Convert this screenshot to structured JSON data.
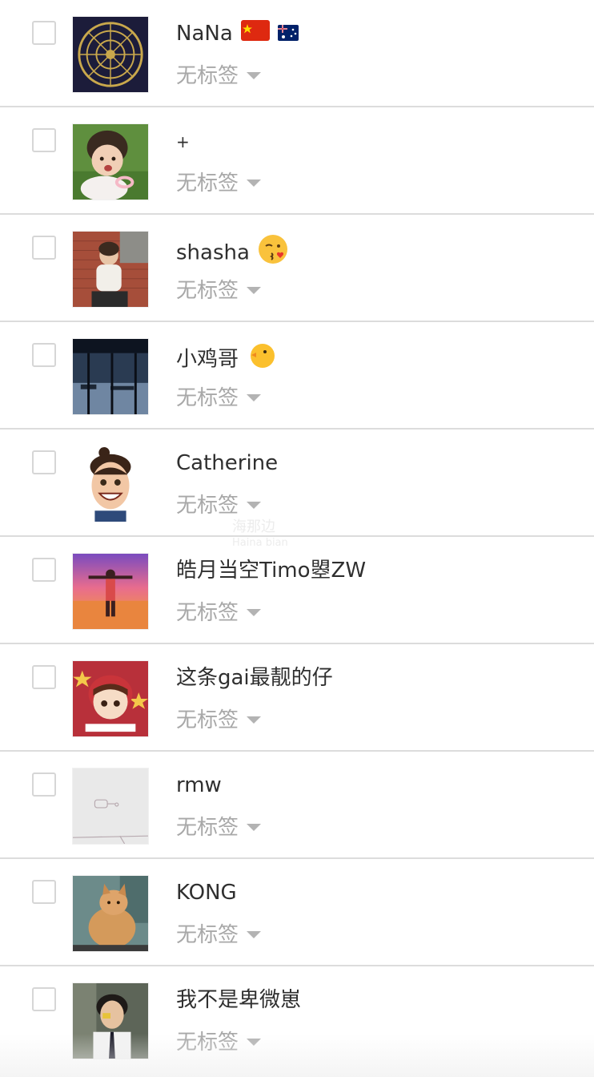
{
  "contacts": [
    {
      "name": "NaNa",
      "tag_label": "无标签"
    },
    {
      "name": "+",
      "tag_label": "无标签"
    },
    {
      "name": "shasha",
      "tag_label": "无标签"
    },
    {
      "name": "小鸡哥",
      "tag_label": "无标签"
    },
    {
      "name": "Catherine",
      "tag_label": "无标签"
    },
    {
      "name": "皓月当空Timo曌ZW",
      "tag_label": "无标签"
    },
    {
      "name": "这条gai最靓的仔",
      "tag_label": "无标签"
    },
    {
      "name": "rmw",
      "tag_label": "无标签"
    },
    {
      "name": "KONG",
      "tag_label": "无标签"
    },
    {
      "name": "我不是卑微崽",
      "tag_label": "无标签"
    }
  ],
  "watermark": {
    "line1": "海那边",
    "line2": "Haina bian"
  },
  "colors": {
    "name_text": "#2f2f2f",
    "tag_text": "#a8a8a8",
    "divider": "#dcdcdc"
  }
}
